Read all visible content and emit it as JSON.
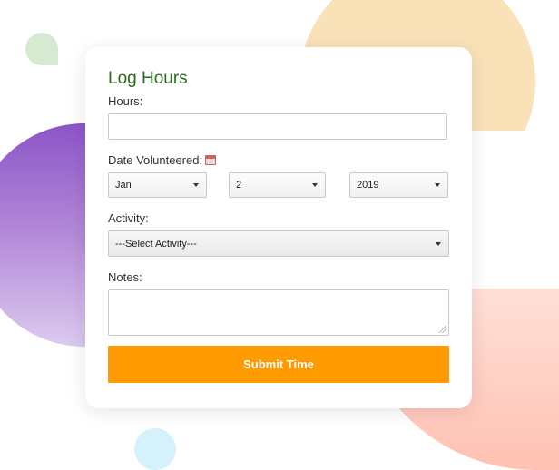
{
  "form": {
    "title": "Log Hours",
    "hours_label": "Hours:",
    "hours_value": "",
    "date_label": "Date Volunteered:",
    "month_value": "Jan",
    "day_value": "2",
    "year_value": "2019",
    "activity_label": "Activity:",
    "activity_value": "---Select Activity---",
    "notes_label": "Notes:",
    "notes_value": "",
    "submit_label": "Submit Time"
  },
  "colors": {
    "title": "#2e6a1e",
    "submit_button": "#ff9a00",
    "blob_orange": "#f9e1b8",
    "blob_purple": "#8c55c8",
    "blob_pink": "#ffc1b2",
    "blob_green": "#d6ead2",
    "blob_blue": "#d5f1fb"
  },
  "icons": {
    "date": "calendar-icon",
    "select": "chevron-down-icon"
  }
}
